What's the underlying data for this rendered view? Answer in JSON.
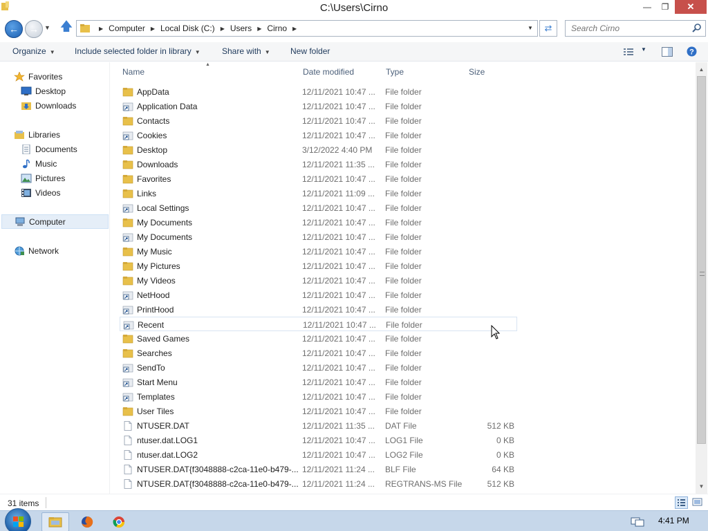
{
  "window": {
    "title": "C:\\Users\\Cirno",
    "minimize": "—",
    "maximize": "❐",
    "close": "✕"
  },
  "address": {
    "crumbs": [
      "Computer",
      "Local Disk (C:)",
      "Users",
      "Cirno"
    ],
    "search_placeholder": "Search Cirno"
  },
  "toolbar": {
    "organize": "Organize",
    "include": "Include selected folder in library",
    "share": "Share with",
    "new_folder": "New folder"
  },
  "nav": {
    "favorites": "Favorites",
    "desktop": "Desktop",
    "downloads": "Downloads",
    "libraries": "Libraries",
    "documents": "Documents",
    "music": "Music",
    "pictures": "Pictures",
    "videos": "Videos",
    "computer": "Computer",
    "network": "Network"
  },
  "columns": {
    "name": "Name",
    "date": "Date modified",
    "type": "Type",
    "size": "Size"
  },
  "files": [
    {
      "name": "AppData",
      "date": "12/11/2021 10:47 ...",
      "type": "File folder",
      "size": "",
      "icon": "folder"
    },
    {
      "name": "Application Data",
      "date": "12/11/2021 10:47 ...",
      "type": "File folder",
      "size": "",
      "icon": "shortcut"
    },
    {
      "name": "Contacts",
      "date": "12/11/2021 10:47 ...",
      "type": "File folder",
      "size": "",
      "icon": "folder"
    },
    {
      "name": "Cookies",
      "date": "12/11/2021 10:47 ...",
      "type": "File folder",
      "size": "",
      "icon": "shortcut"
    },
    {
      "name": "Desktop",
      "date": "3/12/2022 4:40 PM",
      "type": "File folder",
      "size": "",
      "icon": "folder"
    },
    {
      "name": "Downloads",
      "date": "12/11/2021 11:35 ...",
      "type": "File folder",
      "size": "",
      "icon": "folder"
    },
    {
      "name": "Favorites",
      "date": "12/11/2021 10:47 ...",
      "type": "File folder",
      "size": "",
      "icon": "folder"
    },
    {
      "name": "Links",
      "date": "12/11/2021 11:09 ...",
      "type": "File folder",
      "size": "",
      "icon": "folder"
    },
    {
      "name": "Local Settings",
      "date": "12/11/2021 10:47 ...",
      "type": "File folder",
      "size": "",
      "icon": "shortcut"
    },
    {
      "name": "My Documents",
      "date": "12/11/2021 10:47 ...",
      "type": "File folder",
      "size": "",
      "icon": "folder"
    },
    {
      "name": "My Documents",
      "date": "12/11/2021 10:47 ...",
      "type": "File folder",
      "size": "",
      "icon": "shortcut"
    },
    {
      "name": "My Music",
      "date": "12/11/2021 10:47 ...",
      "type": "File folder",
      "size": "",
      "icon": "folder"
    },
    {
      "name": "My Pictures",
      "date": "12/11/2021 10:47 ...",
      "type": "File folder",
      "size": "",
      "icon": "folder"
    },
    {
      "name": "My Videos",
      "date": "12/11/2021 10:47 ...",
      "type": "File folder",
      "size": "",
      "icon": "folder"
    },
    {
      "name": "NetHood",
      "date": "12/11/2021 10:47 ...",
      "type": "File folder",
      "size": "",
      "icon": "shortcut"
    },
    {
      "name": "PrintHood",
      "date": "12/11/2021 10:47 ...",
      "type": "File folder",
      "size": "",
      "icon": "shortcut"
    },
    {
      "name": "Recent",
      "date": "12/11/2021 10:47 ...",
      "type": "File folder",
      "size": "",
      "icon": "shortcut"
    },
    {
      "name": "Saved Games",
      "date": "12/11/2021 10:47 ...",
      "type": "File folder",
      "size": "",
      "icon": "folder"
    },
    {
      "name": "Searches",
      "date": "12/11/2021 10:47 ...",
      "type": "File folder",
      "size": "",
      "icon": "folder"
    },
    {
      "name": "SendTo",
      "date": "12/11/2021 10:47 ...",
      "type": "File folder",
      "size": "",
      "icon": "shortcut"
    },
    {
      "name": "Start Menu",
      "date": "12/11/2021 10:47 ...",
      "type": "File folder",
      "size": "",
      "icon": "shortcut"
    },
    {
      "name": "Templates",
      "date": "12/11/2021 10:47 ...",
      "type": "File folder",
      "size": "",
      "icon": "shortcut"
    },
    {
      "name": "User Tiles",
      "date": "12/11/2021 10:47 ...",
      "type": "File folder",
      "size": "",
      "icon": "folder"
    },
    {
      "name": "NTUSER.DAT",
      "date": "12/11/2021 11:35 ...",
      "type": "DAT File",
      "size": "512 KB",
      "icon": "file"
    },
    {
      "name": "ntuser.dat.LOG1",
      "date": "12/11/2021 10:47 ...",
      "type": "LOG1 File",
      "size": "0 KB",
      "icon": "file"
    },
    {
      "name": "ntuser.dat.LOG2",
      "date": "12/11/2021 10:47 ...",
      "type": "LOG2 File",
      "size": "0 KB",
      "icon": "file"
    },
    {
      "name": "NTUSER.DAT{f3048888-c2ca-11e0-b479-...",
      "date": "12/11/2021 11:24 ...",
      "type": "BLF File",
      "size": "64 KB",
      "icon": "file"
    },
    {
      "name": "NTUSER.DAT{f3048888-c2ca-11e0-b479-...",
      "date": "12/11/2021 11:24 ...",
      "type": "REGTRANS-MS File",
      "size": "512 KB",
      "icon": "file"
    }
  ],
  "status": {
    "item_count": "31 items"
  },
  "taskbar": {
    "clock": "4:41 PM"
  }
}
